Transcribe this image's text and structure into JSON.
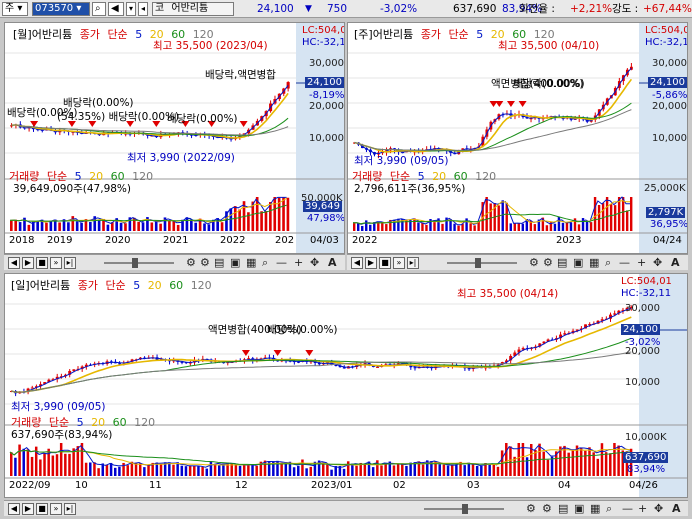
{
  "toolbar": {
    "market": "주",
    "code": "073570",
    "board": "코",
    "name": "어반리튬",
    "price": "24,100",
    "arrow": "▼",
    "change": "750",
    "change_pct": "-3,02%",
    "volume": "637,690",
    "volume_ratio": "83,94%",
    "turnover_label": "회전율 :",
    "turnover": "+2,21%",
    "strength_label": "강도 :",
    "strength": "+67,44%"
  },
  "colors": {
    "up": "#e00000",
    "down": "#0000d0",
    "ma5": "#0018c8",
    "ma20": "#e6b800",
    "ma60": "#1b8f1b",
    "ma120": "#7a7a7a",
    "axis_bg": "#d6e4f2"
  },
  "monthly": {
    "title": "[월]어반리튬",
    "price_lbl": "종가",
    "ma_lbl": "단순",
    "ma5": "5",
    "ma20": "20",
    "ma60": "60",
    "ma120": "120",
    "lc": "LC:504,0",
    "hc": "HC:-32,1",
    "high": "최고 35,500 (2023/04)",
    "low": "최저 3,990 (2022/09)",
    "ann1": "배당락(0.00%)",
    "ann2": "배당락(0.00%)",
    "ann3": "배당락(0.00%)",
    "ann4": "배당락,액면병합",
    "overlap1": "(54.35%) 배당락(0.00%)",
    "overlap2": "배당락(0.00%)",
    "scale": [
      "30,000",
      "20,000",
      "10,000"
    ],
    "price_box": "24,100",
    "price_pct": "-8,19%",
    "vol_title": "거래량",
    "vol_value": "39,649,090주(47,98%)",
    "vol_scale": "50,000K",
    "vol_box": "39,649",
    "vol_pct": "47,98%",
    "dates": [
      "2018",
      "2019",
      "2020",
      "2021",
      "2022",
      "202"
    ],
    "end_date": "04/03"
  },
  "weekly": {
    "title": "[주]어반리튬",
    "price_lbl": "종가",
    "ma_lbl": "단순",
    "ma5": "5",
    "ma20": "20",
    "ma60": "60",
    "ma120": "120",
    "lc": "LC:504,0",
    "hc": "HC:-32,1",
    "high": "최고 35,500 (04/10)",
    "low": "최저 3,990 (09/05)",
    "ann1": "액면병합(400.00%)",
    "ann2": "배당락(0.00%)",
    "scale": [
      "30,000",
      "20,000",
      "10,000"
    ],
    "price_box": "24,100",
    "price_pct": "-5,86%",
    "vol_title": "거래량",
    "vol_value": "2,796,611주(36,95%)",
    "vol_scale": "25,000K",
    "vol_box": "2,797K",
    "vol_pct": "36,95%",
    "dates": [
      "2022",
      "2023"
    ],
    "end_date": "04/24"
  },
  "daily": {
    "title": "[일]어반리튬",
    "price_lbl": "종가",
    "ma_lbl": "단순",
    "ma5": "5",
    "ma20": "20",
    "ma60": "60",
    "ma120": "120",
    "lc": "LC:504,01",
    "hc": "HC:-32,11",
    "high": "최고 35,500 (04/14)",
    "low": "최저 3,990 (09/05)",
    "ann1": "액면병합(400.00%)",
    "ann2": "배당락(0.00%)",
    "scale": [
      "30,000",
      "20,000",
      "10,000"
    ],
    "price_box": "24,100",
    "price_pct": "-3,02%",
    "vol_title": "거래량",
    "vol_value": "637,690주(83,94%)",
    "vol_scale": "10,000K",
    "vol_box": "637,690",
    "vol_pct": "83,94%",
    "dates": [
      "2022/09",
      "10",
      "11",
      "12",
      "2023/01",
      "02",
      "03",
      "04"
    ],
    "end_date": "04/26"
  }
}
